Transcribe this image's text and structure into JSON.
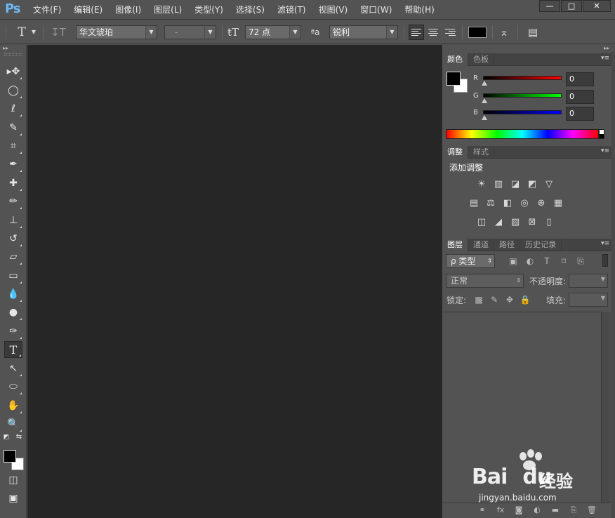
{
  "app": {
    "logo": "Ps",
    "menu": [
      "文件(F)",
      "编辑(E)",
      "图像(I)",
      "图层(L)",
      "类型(Y)",
      "选择(S)",
      "滤镜(T)",
      "视图(V)",
      "窗口(W)",
      "帮助(H)"
    ],
    "window_controls": [
      "—",
      "□",
      "✕"
    ]
  },
  "options": {
    "tool_glyph": "T",
    "font_family": "华文琥珀",
    "font_style": "-",
    "font_size": "72 点",
    "aa_label": "ªa",
    "antialias": "锐利",
    "text_color": "#000000"
  },
  "tools": [
    {
      "name": "move-tool",
      "glyph": "▸✥"
    },
    {
      "name": "marquee-tool",
      "glyph": "◯"
    },
    {
      "name": "lasso-tool",
      "glyph": "ℓ"
    },
    {
      "name": "quick-select-tool",
      "glyph": "✎"
    },
    {
      "name": "crop-tool",
      "glyph": "⌗"
    },
    {
      "name": "eyedropper-tool",
      "glyph": "✒"
    },
    {
      "name": "healing-brush-tool",
      "glyph": "✚"
    },
    {
      "name": "brush-tool",
      "glyph": "✏"
    },
    {
      "name": "clone-stamp-tool",
      "glyph": "⊥"
    },
    {
      "name": "history-brush-tool",
      "glyph": "↺"
    },
    {
      "name": "eraser-tool",
      "glyph": "▱"
    },
    {
      "name": "gradient-tool",
      "glyph": "▭"
    },
    {
      "name": "blur-tool",
      "glyph": "💧"
    },
    {
      "name": "dodge-tool",
      "glyph": "●"
    },
    {
      "name": "pen-tool",
      "glyph": "✑"
    },
    {
      "name": "type-tool",
      "glyph": "T"
    },
    {
      "name": "path-select-tool",
      "glyph": "↖"
    },
    {
      "name": "ellipse-tool",
      "glyph": "⬭"
    },
    {
      "name": "hand-tool",
      "glyph": "✋"
    },
    {
      "name": "zoom-tool",
      "glyph": "🔍"
    }
  ],
  "toolbox_extra": {
    "reset_glyph": "◩",
    "swap_glyph": "⇆",
    "quickmask_glyph": "◫",
    "screenmode_glyph": "▣"
  },
  "color_panel": {
    "tabs": [
      "颜色",
      "色板"
    ],
    "channels": [
      {
        "label": "R",
        "value": "0",
        "gradient": "linear-gradient(to right, #000, #ff0000)"
      },
      {
        "label": "G",
        "value": "0",
        "gradient": "linear-gradient(to right, #000, #00ff00)"
      },
      {
        "label": "B",
        "value": "0",
        "gradient": "linear-gradient(to right, #000, #0000ff)"
      }
    ]
  },
  "adjust_panel": {
    "tabs": [
      "调整",
      "样式"
    ],
    "title": "添加调整",
    "rows": [
      [
        "☀",
        "▥",
        "◪",
        "◩",
        "▽"
      ],
      [
        "▤",
        "⚖",
        "◧",
        "◎",
        "⊕",
        "▦"
      ],
      [
        "◫",
        "◢",
        "▨",
        "⊠",
        "▯"
      ]
    ]
  },
  "layers_panel": {
    "tabs": [
      "图层",
      "通道",
      "路径",
      "历史记录"
    ],
    "filter_label": "ρ 类型",
    "filter_icons": [
      "▣",
      "◐",
      "T",
      "⌑",
      "⎘"
    ],
    "blend_mode": "正常",
    "opacity_label": "不透明度:",
    "lock_label": "锁定:",
    "lock_icons": [
      "▩",
      "✎",
      "✥",
      "🔒"
    ],
    "fill_label": "填充:",
    "footer_icons": [
      "⚭",
      "fx",
      "◙",
      "◐",
      "▬",
      "⎘",
      "🗑"
    ]
  },
  "watermark": {
    "brand": "Bai",
    "brand2": "du",
    "brand_cn": "经验",
    "url": "jingyan.baidu.com"
  }
}
